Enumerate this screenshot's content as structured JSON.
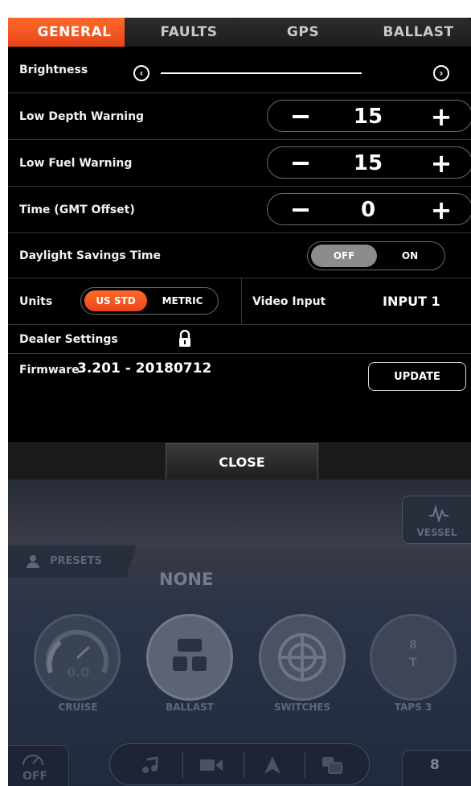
{
  "tabs": [
    {
      "label": "GENERAL",
      "active": true
    },
    {
      "label": "FAULTS",
      "active": false
    },
    {
      "label": "GPS",
      "active": false
    },
    {
      "label": "BALLAST",
      "active": false
    }
  ],
  "settings": {
    "brightness": {
      "label": "Brightness"
    },
    "low_depth": {
      "label": "Low Depth Warning",
      "value": "15"
    },
    "low_fuel": {
      "label": "Low Fuel Warning",
      "value": "15"
    },
    "time_offset": {
      "label": "Time (GMT Offset)",
      "value": "0"
    },
    "daylight": {
      "label": "Daylight Savings Time",
      "off_label": "OFF",
      "on_label": "ON",
      "selected": "OFF"
    },
    "units": {
      "label": "Units",
      "us_label": "US STD",
      "metric_label": "METRIC",
      "selected": "US STD"
    },
    "video": {
      "label": "Video Input",
      "value": "INPUT 1"
    },
    "dealer": {
      "label": "Dealer Settings"
    },
    "firmware": {
      "label": "Firmware",
      "version": "3.201 - 20180712",
      "update_label": "UPDATE"
    }
  },
  "close_label": "CLOSE",
  "dashboard": {
    "vessel_label": "VESSEL",
    "presets_label": "PRESETS",
    "preset_value": "NONE",
    "gauges": [
      {
        "label": "CRUISE",
        "inner": "0.0"
      },
      {
        "label": "BALLAST"
      },
      {
        "label": "SWITCHES"
      },
      {
        "label": "TAPS 3",
        "inner_top": "8",
        "inner_bottom": "T"
      }
    ],
    "left_corner_label": "OFF",
    "right_corner_label": "8"
  },
  "colors": {
    "accent": "#f05a1e",
    "background": "#000000",
    "dashboard": "#2a3446"
  }
}
